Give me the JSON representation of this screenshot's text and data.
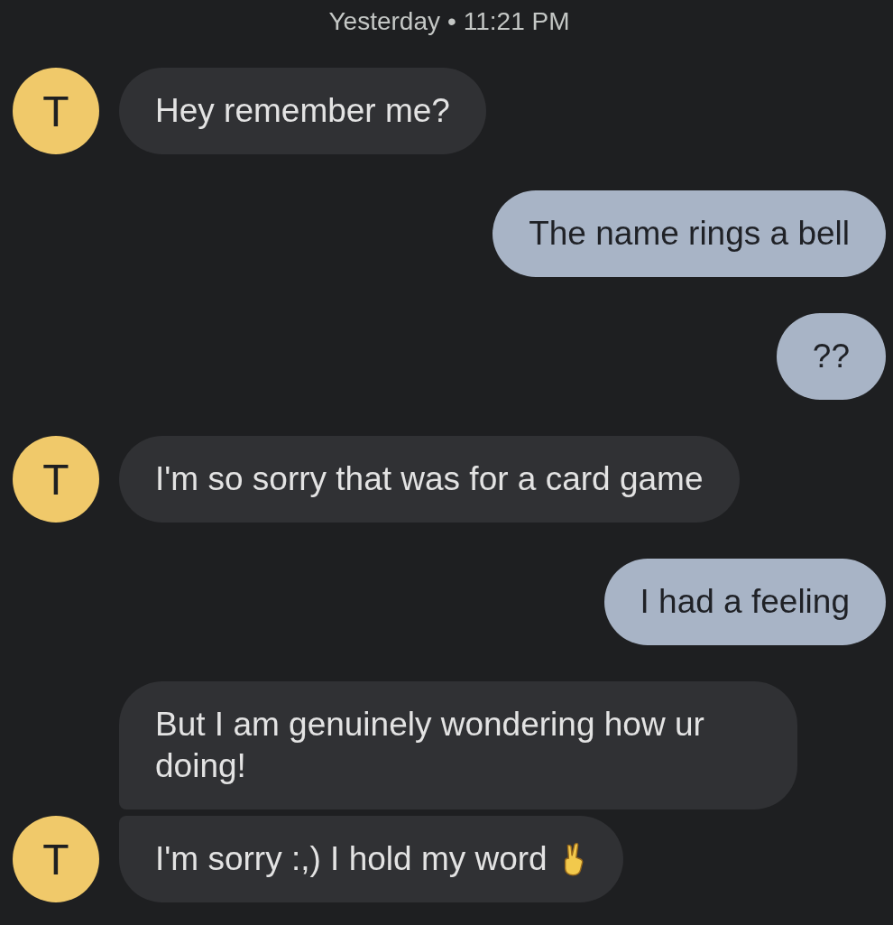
{
  "timestamp": {
    "day": "Yesterday",
    "separator": "•",
    "time": "11:21 PM"
  },
  "messages": [
    {
      "kind": "incoming",
      "avatar": "T",
      "text": "Hey remember me?"
    },
    {
      "kind": "outgoing",
      "text": "The name rings a bell"
    },
    {
      "kind": "outgoing",
      "text": "??"
    },
    {
      "kind": "incoming",
      "avatar": "T",
      "text": "I'm so sorry that was for a card game"
    },
    {
      "kind": "outgoing",
      "text": "I had a feeling"
    },
    {
      "kind": "incoming",
      "text": "But I am genuinely wondering how ur doing!"
    },
    {
      "kind": "incoming_emoji",
      "avatar": "T",
      "text": "I'm sorry :,) I hold my word"
    }
  ]
}
